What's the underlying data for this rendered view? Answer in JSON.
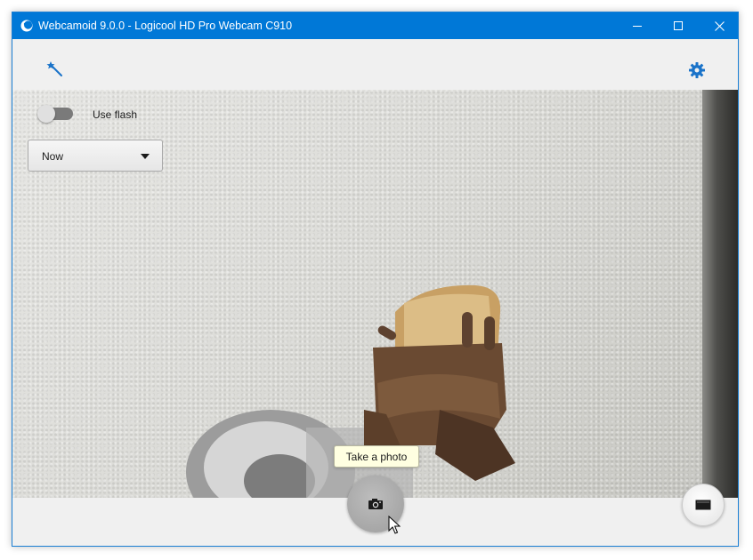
{
  "window": {
    "title": "Webcamoid 9.0.0 - Logicool HD Pro Webcam C910",
    "app_icon": "webcamoid-logo-icon",
    "controls": {
      "minimize_icon": "minimize-icon",
      "maximize_icon": "maximize-icon",
      "close_icon": "close-icon"
    }
  },
  "toolbar": {
    "effects_icon": "magic-wand-icon",
    "settings_icon": "gear-icon",
    "accent_color": "#0078d7"
  },
  "preview": {
    "flash": {
      "label": "Use flash",
      "enabled": false
    },
    "timer_select": {
      "value": "Now"
    }
  },
  "capture": {
    "tooltip": "Take a photo",
    "photo_icon": "camera-icon",
    "record_icon": "video-record-icon"
  }
}
